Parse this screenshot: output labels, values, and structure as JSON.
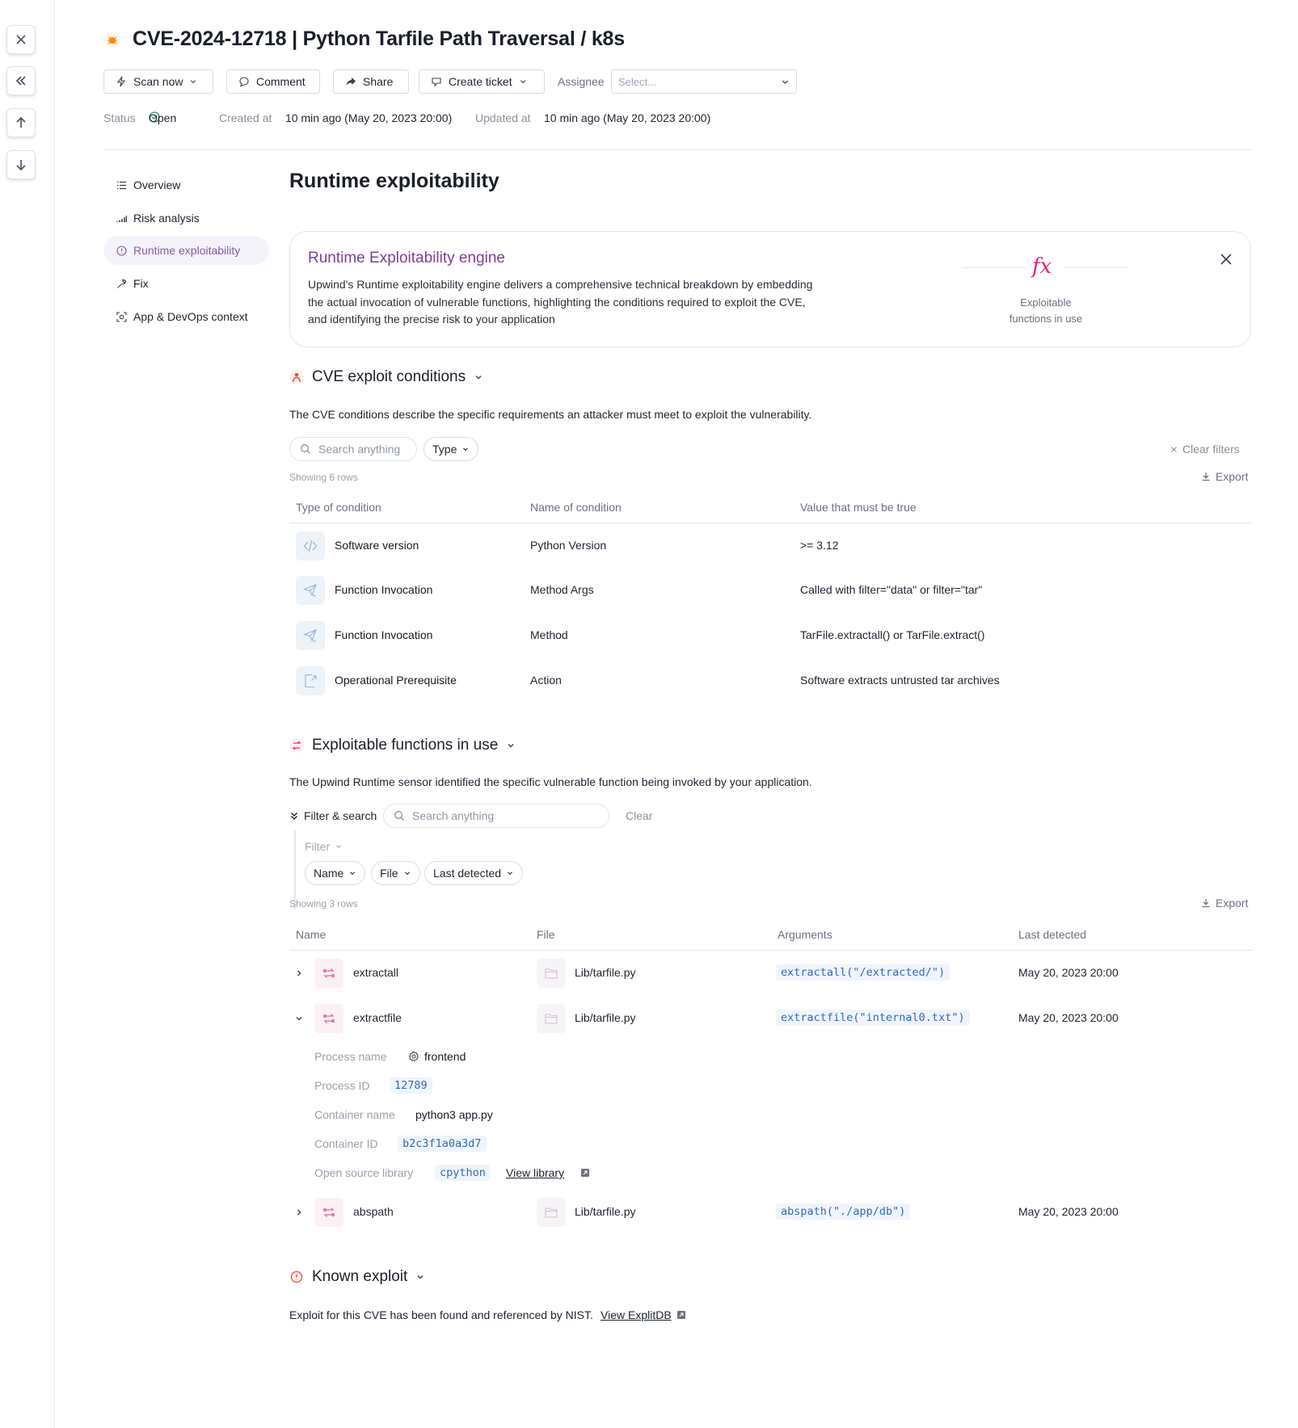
{
  "rail": {
    "icons": [
      "close-icon",
      "collapse-icon",
      "arrow-up-icon",
      "arrow-down-icon"
    ]
  },
  "header": {
    "title": "CVE-2024-12718 | Python Tarfile Path Traversal / k8s",
    "buttons": {
      "scan": "Scan now",
      "comment": "Comment",
      "share": "Share",
      "ticket": "Create ticket"
    },
    "assignee_label": "Assignee",
    "assignee_placeholder": "Select...",
    "status_label": "Status",
    "status_value": "Open",
    "created_label": "Created at",
    "created_value": "10 min ago (May 20, 2023 20:00)",
    "updated_label": "Updated at",
    "updated_value": "10 min ago (May 20, 2023 20:00)"
  },
  "nav": [
    {
      "label": "Overview"
    },
    {
      "label": "Risk analysis"
    },
    {
      "label": "Runtime exploitability"
    },
    {
      "label": "Fix"
    },
    {
      "label": "App & DevOps context"
    }
  ],
  "main": {
    "title": "Runtime exploitability",
    "engine": {
      "title": "Runtime Exploitability engine",
      "desc_lines": [
        "Upwind's Runtime exploitability engine delivers a comprehensive technical breakdown by embedding",
        "the actual invocation of vulnerable functions, highlighting the conditions required to exploit the CVE,",
        "and identifying the precise risk to your application"
      ],
      "fx": "fx",
      "caption_lines": [
        "Exploitable",
        "functions in use"
      ]
    },
    "conditions": {
      "title": "CVE exploit conditions",
      "desc": "The CVE conditions describe the specific requirements an attacker must meet to exploit the vulnerability.",
      "search_placeholder": "Search anything",
      "type_filter": "Type",
      "clear_filters": "Clear filters",
      "showing": "Showing 6 rows",
      "export": "Export",
      "columns": [
        "Type of condition",
        "Name of condition",
        "Value that must be true"
      ],
      "rows": [
        {
          "type": "Software version",
          "name": "Python Version",
          "value": ">= 3.12"
        },
        {
          "type": "Function Invocation",
          "name": "Method Args",
          "value": "Called with filter=\"data\" or filter=\"tar\""
        },
        {
          "type": "Function Invocation",
          "name": "Method",
          "value": "TarFile.extractall() or TarFile.extract()"
        },
        {
          "type": "Operational Prerequisite",
          "name": "Action",
          "value": "Software extracts untrusted tar archives"
        }
      ]
    },
    "functions": {
      "title": "Exploitable functions in use",
      "desc": "The Upwind Runtime sensor identified the specific vulnerable function being invoked by your application.",
      "filter_search": "Filter & search",
      "search_placeholder": "Search anything",
      "clear": "Clear",
      "filter_label": "Filter",
      "filters": [
        "Name",
        "File",
        "Last detected"
      ],
      "showing": "Showing 3 rows",
      "export": "Export",
      "columns": [
        "Name",
        "File",
        "Arguments",
        "Last detected"
      ],
      "rows": [
        {
          "name": "extractall",
          "file": "Lib/tarfile.py",
          "args": "extractall(\"/extracted/\")",
          "detected": "May 20, 2023 20:00"
        },
        {
          "name": "extractfile",
          "file": "Lib/tarfile.py",
          "args": "extractfile(\"internal0.txt\")",
          "detected": "May 20, 2023 20:00"
        },
        {
          "name": "abspath",
          "file": "Lib/tarfile.py",
          "args": "abspath(\"./app/db\")",
          "detected": "May 20, 2023 20:00"
        }
      ],
      "details": {
        "process_name_label": "Process name",
        "process_name": "frontend",
        "process_id_label": "Process ID",
        "process_id": "12789",
        "container_name_label": "Container name",
        "container_name": "python3 app.py",
        "container_id_label": "Container ID",
        "container_id": "b2c3f1a0a3d7",
        "library_label": "Open source library",
        "library": "cpython",
        "view_library": "View library"
      }
    },
    "known_exploit": {
      "title": "Known exploit",
      "desc": "Exploit for this CVE has been found and referenced by NIST.",
      "link": "View ExplitDB"
    }
  },
  "colors": {
    "accent": "#8a5aa8",
    "fx": "#e0247a",
    "code": "#2d6cc0",
    "status_ok": "#2a9d5c"
  }
}
